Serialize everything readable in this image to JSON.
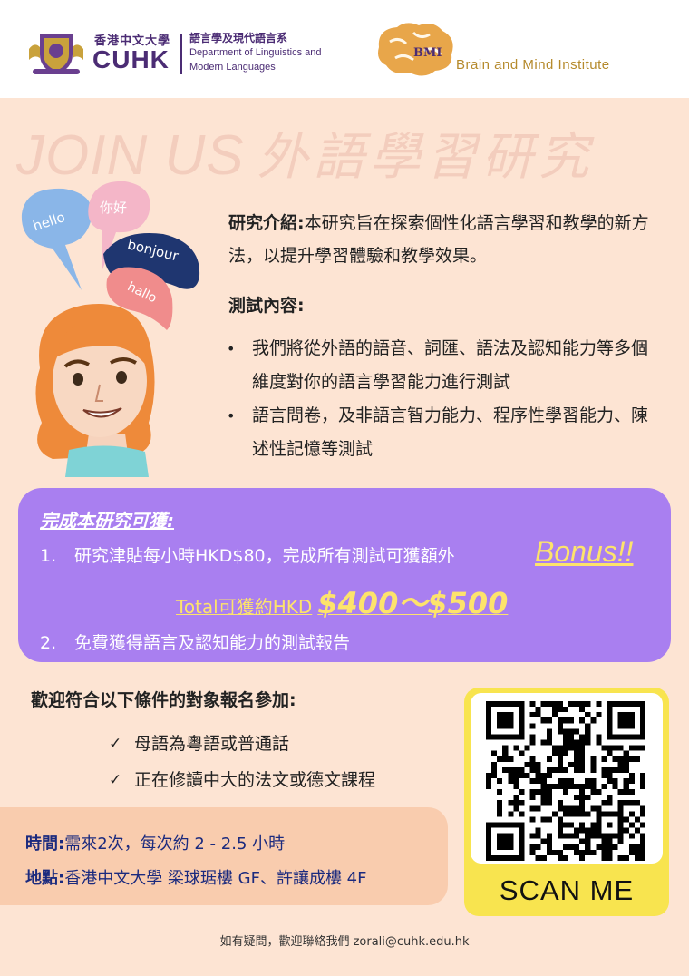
{
  "header": {
    "cuhk_name_cn": "香港中文大學",
    "cuhk_name_en": "CUHK",
    "dept_cn": "語言學及現代語言系",
    "dept_en_line1": "Department of Linguistics and",
    "dept_en_line2": "Modern Languages",
    "bmi_letters": "BMI",
    "bmi_name": "Brain and Mind Institute"
  },
  "title": {
    "en": "JOIN US",
    "cn": "外語學習研究"
  },
  "illustration": {
    "bubbles": [
      "hello",
      "你好",
      "bonjour",
      "hallo"
    ]
  },
  "intro": {
    "label": "研究介紹:",
    "text": "本研究旨在探索個性化語言學習和教學的新方法，以提升學習體驗和教學效果。"
  },
  "test_content": {
    "label": "測試內容:",
    "items": [
      "我們將從外語的語音、詞匯、語法及認知能力等多個維度對你的語言學習能力進行測試",
      "語言問卷，及非語言智力能力、程序性學習能力、陳述性記憶等測試"
    ]
  },
  "benefits": {
    "title": "完成本研究可獲:",
    "item1_num": "1.",
    "item1_text": "研究津貼每小時HKD$80，完成所有測試可獲額外",
    "bonus": "Bonus!!",
    "total_label": "Total可獲約HKD",
    "total_range": "$400～$500",
    "item2_num": "2.",
    "item2_text": "免費獲得語言及認知能力的測試報告"
  },
  "eligibility": {
    "label": "歡迎符合以下條件的對象報名參加:",
    "items": [
      "母語為粵語或普通話",
      "正在修讀中大的法文或德文課程"
    ]
  },
  "logistics": {
    "time_label": "時間:",
    "time_value": "需來2次，每次約 2 - 2.5 小時",
    "place_label": "地點:",
    "place_value": "香港中文大學 梁球琚樓 GF、許讓成樓 4F"
  },
  "qr": {
    "cta": "SCAN ME"
  },
  "footer": {
    "contact": "如有疑問，歡迎聯絡我們 zorali@cuhk.edu.hk"
  },
  "colors": {
    "background": "#fde4d3",
    "purple": "#a97ff0",
    "gold": "#fde36b",
    "navy": "#1b2a7e",
    "qr_panel": "#f8e44f",
    "cuhk_purple": "#4b2c74"
  }
}
